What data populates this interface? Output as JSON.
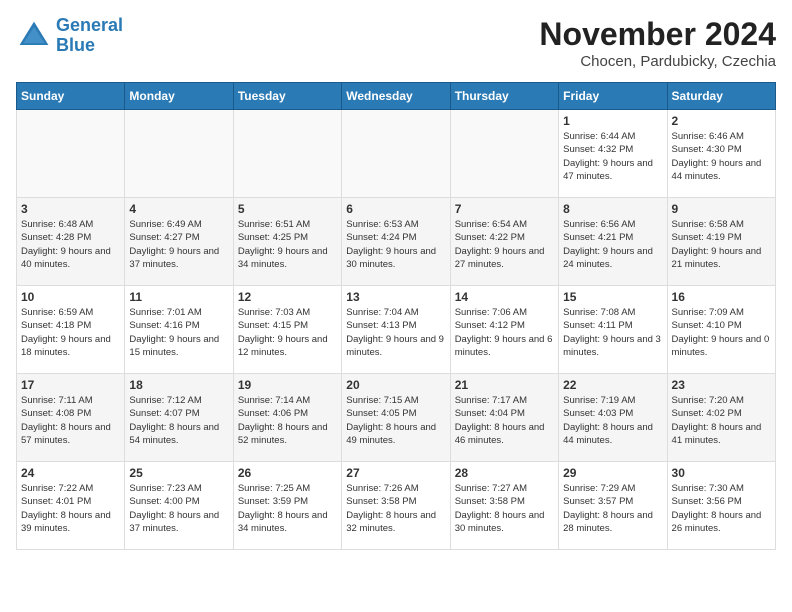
{
  "logo": {
    "line1": "General",
    "line2": "Blue"
  },
  "title": "November 2024",
  "location": "Chocen, Pardubicky, Czechia",
  "weekdays": [
    "Sunday",
    "Monday",
    "Tuesday",
    "Wednesday",
    "Thursday",
    "Friday",
    "Saturday"
  ],
  "weeks": [
    [
      {
        "day": "",
        "info": ""
      },
      {
        "day": "",
        "info": ""
      },
      {
        "day": "",
        "info": ""
      },
      {
        "day": "",
        "info": ""
      },
      {
        "day": "",
        "info": ""
      },
      {
        "day": "1",
        "info": "Sunrise: 6:44 AM\nSunset: 4:32 PM\nDaylight: 9 hours and 47 minutes."
      },
      {
        "day": "2",
        "info": "Sunrise: 6:46 AM\nSunset: 4:30 PM\nDaylight: 9 hours and 44 minutes."
      }
    ],
    [
      {
        "day": "3",
        "info": "Sunrise: 6:48 AM\nSunset: 4:28 PM\nDaylight: 9 hours and 40 minutes."
      },
      {
        "day": "4",
        "info": "Sunrise: 6:49 AM\nSunset: 4:27 PM\nDaylight: 9 hours and 37 minutes."
      },
      {
        "day": "5",
        "info": "Sunrise: 6:51 AM\nSunset: 4:25 PM\nDaylight: 9 hours and 34 minutes."
      },
      {
        "day": "6",
        "info": "Sunrise: 6:53 AM\nSunset: 4:24 PM\nDaylight: 9 hours and 30 minutes."
      },
      {
        "day": "7",
        "info": "Sunrise: 6:54 AM\nSunset: 4:22 PM\nDaylight: 9 hours and 27 minutes."
      },
      {
        "day": "8",
        "info": "Sunrise: 6:56 AM\nSunset: 4:21 PM\nDaylight: 9 hours and 24 minutes."
      },
      {
        "day": "9",
        "info": "Sunrise: 6:58 AM\nSunset: 4:19 PM\nDaylight: 9 hours and 21 minutes."
      }
    ],
    [
      {
        "day": "10",
        "info": "Sunrise: 6:59 AM\nSunset: 4:18 PM\nDaylight: 9 hours and 18 minutes."
      },
      {
        "day": "11",
        "info": "Sunrise: 7:01 AM\nSunset: 4:16 PM\nDaylight: 9 hours and 15 minutes."
      },
      {
        "day": "12",
        "info": "Sunrise: 7:03 AM\nSunset: 4:15 PM\nDaylight: 9 hours and 12 minutes."
      },
      {
        "day": "13",
        "info": "Sunrise: 7:04 AM\nSunset: 4:13 PM\nDaylight: 9 hours and 9 minutes."
      },
      {
        "day": "14",
        "info": "Sunrise: 7:06 AM\nSunset: 4:12 PM\nDaylight: 9 hours and 6 minutes."
      },
      {
        "day": "15",
        "info": "Sunrise: 7:08 AM\nSunset: 4:11 PM\nDaylight: 9 hours and 3 minutes."
      },
      {
        "day": "16",
        "info": "Sunrise: 7:09 AM\nSunset: 4:10 PM\nDaylight: 9 hours and 0 minutes."
      }
    ],
    [
      {
        "day": "17",
        "info": "Sunrise: 7:11 AM\nSunset: 4:08 PM\nDaylight: 8 hours and 57 minutes."
      },
      {
        "day": "18",
        "info": "Sunrise: 7:12 AM\nSunset: 4:07 PM\nDaylight: 8 hours and 54 minutes."
      },
      {
        "day": "19",
        "info": "Sunrise: 7:14 AM\nSunset: 4:06 PM\nDaylight: 8 hours and 52 minutes."
      },
      {
        "day": "20",
        "info": "Sunrise: 7:15 AM\nSunset: 4:05 PM\nDaylight: 8 hours and 49 minutes."
      },
      {
        "day": "21",
        "info": "Sunrise: 7:17 AM\nSunset: 4:04 PM\nDaylight: 8 hours and 46 minutes."
      },
      {
        "day": "22",
        "info": "Sunrise: 7:19 AM\nSunset: 4:03 PM\nDaylight: 8 hours and 44 minutes."
      },
      {
        "day": "23",
        "info": "Sunrise: 7:20 AM\nSunset: 4:02 PM\nDaylight: 8 hours and 41 minutes."
      }
    ],
    [
      {
        "day": "24",
        "info": "Sunrise: 7:22 AM\nSunset: 4:01 PM\nDaylight: 8 hours and 39 minutes."
      },
      {
        "day": "25",
        "info": "Sunrise: 7:23 AM\nSunset: 4:00 PM\nDaylight: 8 hours and 37 minutes."
      },
      {
        "day": "26",
        "info": "Sunrise: 7:25 AM\nSunset: 3:59 PM\nDaylight: 8 hours and 34 minutes."
      },
      {
        "day": "27",
        "info": "Sunrise: 7:26 AM\nSunset: 3:58 PM\nDaylight: 8 hours and 32 minutes."
      },
      {
        "day": "28",
        "info": "Sunrise: 7:27 AM\nSunset: 3:58 PM\nDaylight: 8 hours and 30 minutes."
      },
      {
        "day": "29",
        "info": "Sunrise: 7:29 AM\nSunset: 3:57 PM\nDaylight: 8 hours and 28 minutes."
      },
      {
        "day": "30",
        "info": "Sunrise: 7:30 AM\nSunset: 3:56 PM\nDaylight: 8 hours and 26 minutes."
      }
    ]
  ]
}
